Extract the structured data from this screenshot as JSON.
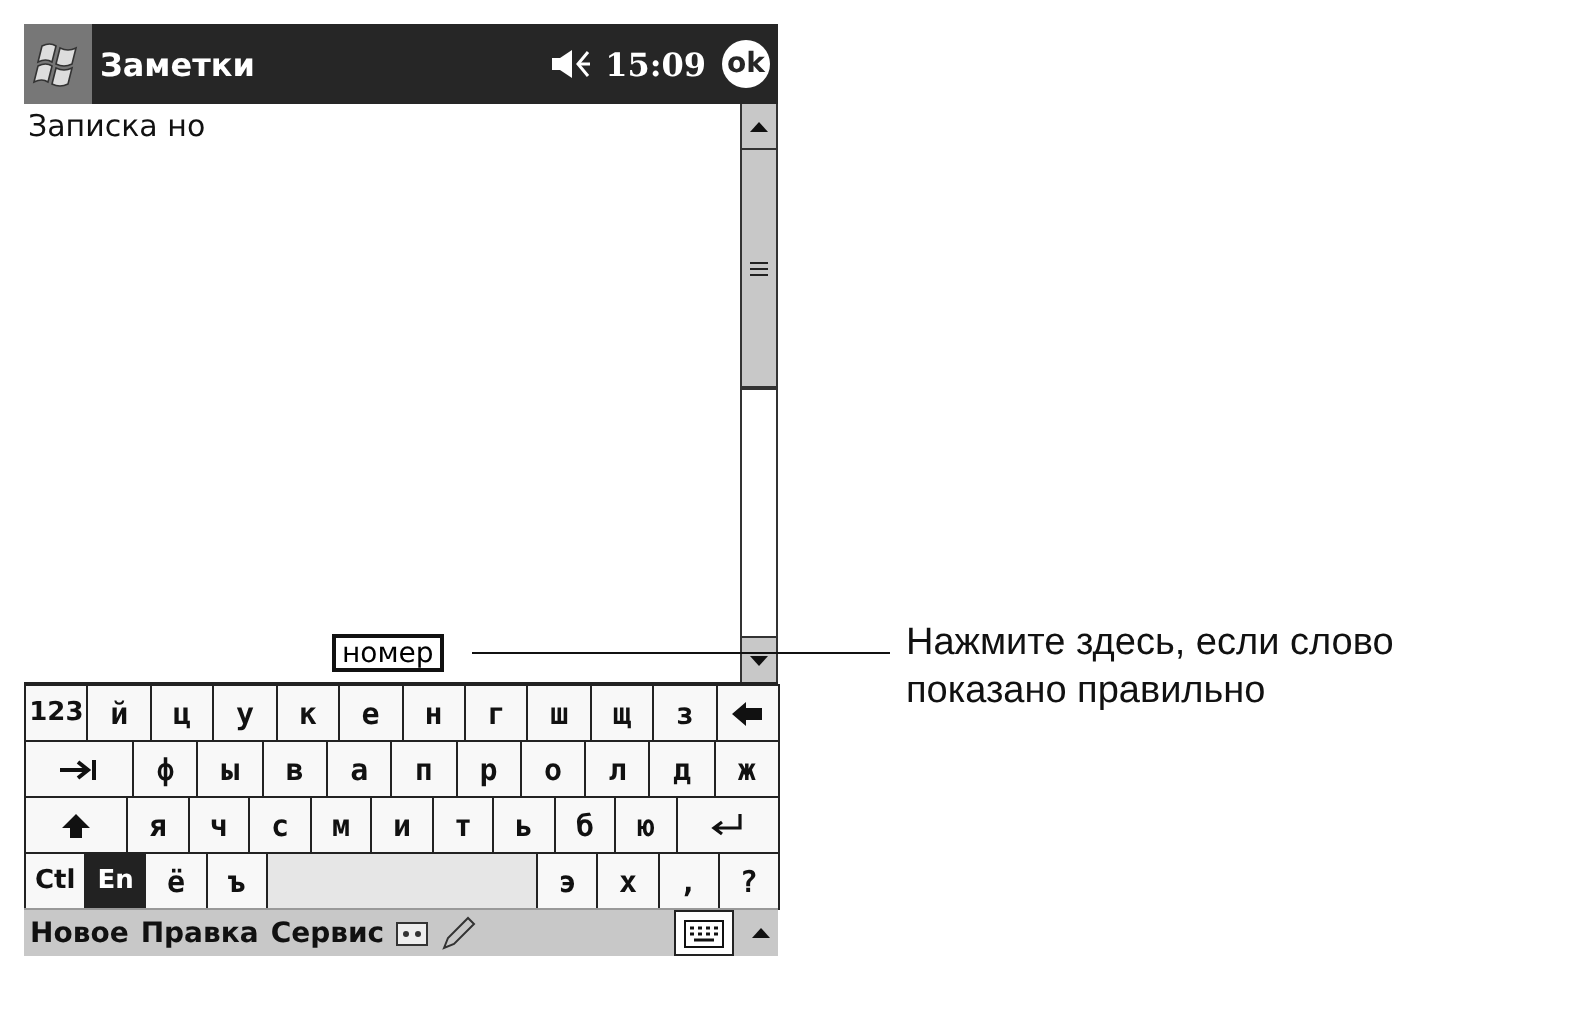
{
  "title_bar": {
    "title": "Заметки",
    "time": "15:09",
    "ok": "ok"
  },
  "note": {
    "text": "Записка но"
  },
  "candidate": {
    "word": "номер"
  },
  "keyboard": {
    "rows": [
      {
        "keys": [
          {
            "kind": "key",
            "label": "123"
          },
          {
            "kind": "key",
            "label": "й"
          },
          {
            "kind": "key",
            "label": "ц"
          },
          {
            "kind": "key",
            "label": "у"
          },
          {
            "kind": "key",
            "label": "к"
          },
          {
            "kind": "key",
            "label": "е"
          },
          {
            "kind": "key",
            "label": "н"
          },
          {
            "kind": "key",
            "label": "г"
          },
          {
            "kind": "key",
            "label": "ш"
          },
          {
            "kind": "key",
            "label": "щ"
          },
          {
            "kind": "key",
            "label": "з"
          },
          {
            "kind": "backspace"
          }
        ]
      },
      {
        "keys": [
          {
            "kind": "tab"
          },
          {
            "kind": "key",
            "label": "ф"
          },
          {
            "kind": "key",
            "label": "ы"
          },
          {
            "kind": "key",
            "label": "в"
          },
          {
            "kind": "key",
            "label": "а"
          },
          {
            "kind": "key",
            "label": "п"
          },
          {
            "kind": "key",
            "label": "р"
          },
          {
            "kind": "key",
            "label": "о"
          },
          {
            "kind": "key",
            "label": "л"
          },
          {
            "kind": "key",
            "label": "д"
          },
          {
            "kind": "key",
            "label": "ж"
          }
        ]
      },
      {
        "keys": [
          {
            "kind": "shift"
          },
          {
            "kind": "key",
            "label": "я"
          },
          {
            "kind": "key",
            "label": "ч"
          },
          {
            "kind": "key",
            "label": "с"
          },
          {
            "kind": "key",
            "label": "м"
          },
          {
            "kind": "key",
            "label": "и"
          },
          {
            "kind": "key",
            "label": "т"
          },
          {
            "kind": "key",
            "label": "ь"
          },
          {
            "kind": "key",
            "label": "б"
          },
          {
            "kind": "key",
            "label": "ю"
          },
          {
            "kind": "enter"
          }
        ]
      },
      {
        "keys": [
          {
            "kind": "toggle",
            "label": "Ctl",
            "on": false
          },
          {
            "kind": "toggle",
            "label": "En",
            "on": true
          },
          {
            "kind": "key",
            "label": "ё"
          },
          {
            "kind": "key",
            "label": "ъ"
          },
          {
            "kind": "space"
          },
          {
            "kind": "key",
            "label": "э"
          },
          {
            "kind": "key",
            "label": "х"
          },
          {
            "kind": "key",
            "label": ","
          },
          {
            "kind": "key",
            "label": "?"
          }
        ]
      }
    ]
  },
  "menu_bar": {
    "items": [
      "Новое",
      "Правка",
      "Сервис"
    ]
  },
  "callout": {
    "text": "Нажмите здесь, если слово показано правильно"
  }
}
